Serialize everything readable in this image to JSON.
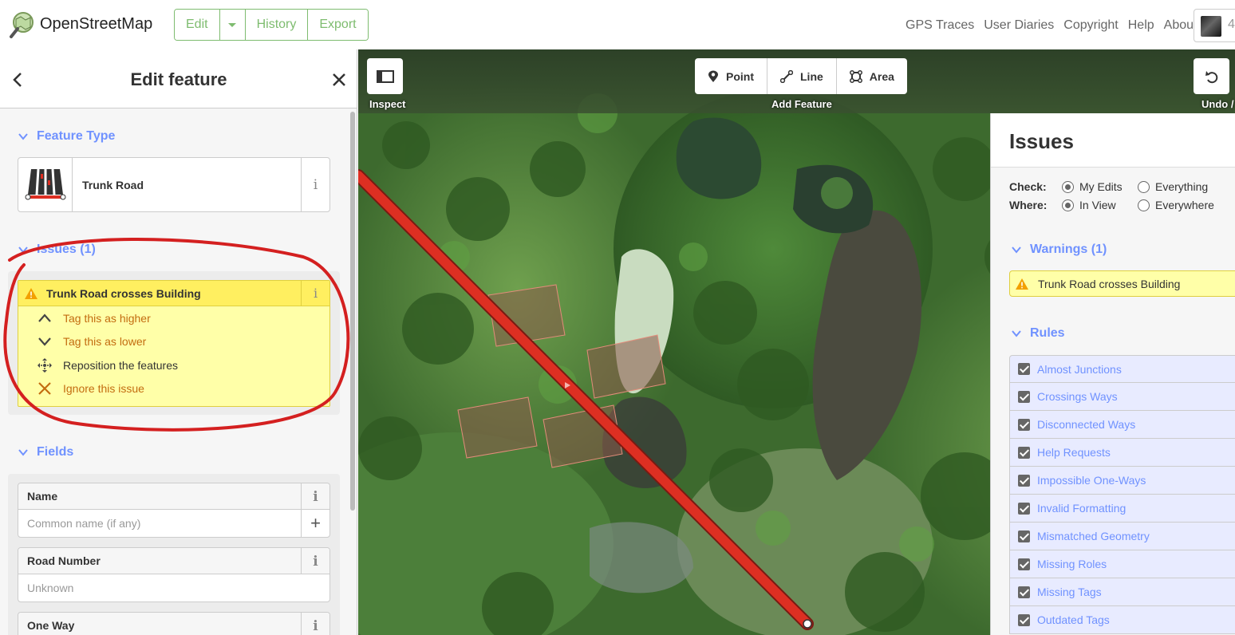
{
  "topbar": {
    "brand": "OpenStreetMap",
    "edit_label": "Edit",
    "history_label": "History",
    "export_label": "Export",
    "links": [
      "GPS Traces",
      "User Diaries",
      "Copyright",
      "Help",
      "About"
    ],
    "user_count": "4"
  },
  "sidebar": {
    "title": "Edit feature",
    "feature_type_section": "Feature Type",
    "feature_type_name": "Trunk Road",
    "issues_section": "Issues (1)",
    "issue_title": "Trunk Road crosses Building",
    "fixes": [
      {
        "label": "Tag this as higher",
        "icon": "chevron-up-icon"
      },
      {
        "label": "Tag this as lower",
        "icon": "chevron-down-icon"
      },
      {
        "label": "Reposition the features",
        "icon": "move-icon"
      },
      {
        "label": "Ignore this issue",
        "icon": "close-icon"
      }
    ],
    "fields_section": "Fields",
    "fields": [
      {
        "label": "Name",
        "placeholder": "Common name (if any)"
      },
      {
        "label": "Road Number",
        "placeholder": "Unknown"
      },
      {
        "label": "One Way",
        "placeholder": ""
      }
    ],
    "info_glyph": "i"
  },
  "map": {
    "inspect_caption": "Inspect",
    "add_feature_caption": "Add Feature",
    "undo_caption": "Undo /",
    "point_label": "Point",
    "line_label": "Line",
    "area_label": "Area"
  },
  "issues_pane": {
    "title": "Issues",
    "check_label": "Check:",
    "where_label": "Where:",
    "check_options": [
      "My Edits",
      "Everything"
    ],
    "where_options": [
      "In View",
      "Everywhere"
    ],
    "warnings_section": "Warnings (1)",
    "warning_item": "Trunk Road crosses Building",
    "rules_section": "Rules",
    "rules": [
      "Almost Junctions",
      "Crossings Ways",
      "Disconnected Ways",
      "Help Requests",
      "Impossible One-Ways",
      "Invalid Formatting",
      "Mismatched Geometry",
      "Missing Roles",
      "Missing Tags",
      "Outdated Tags"
    ]
  },
  "colors": {
    "osm_green": "#7ebc6f",
    "link_blue": "#7092ff",
    "road_red": "#dd2f22",
    "warning_yellow": "#ffef60",
    "annotation_red": "#d42020"
  }
}
